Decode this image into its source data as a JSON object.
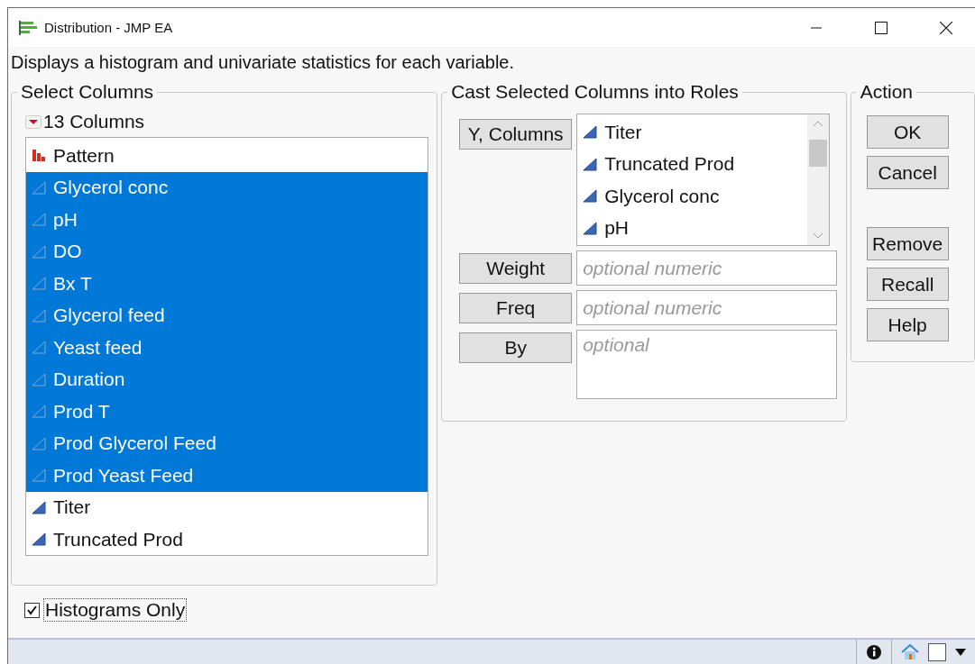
{
  "window": {
    "title": "Distribution - JMP EA"
  },
  "description": "Displays a histogram and univariate statistics for each variable.",
  "select_columns": {
    "title": "Select Columns",
    "count": "13 Columns",
    "columns": [
      {
        "name": "Pattern",
        "kind": "nominal",
        "selected": false
      },
      {
        "name": "Glycerol conc",
        "kind": "continuous",
        "selected": true
      },
      {
        "name": "pH",
        "kind": "continuous",
        "selected": true
      },
      {
        "name": "DO",
        "kind": "continuous",
        "selected": true
      },
      {
        "name": "Bx T",
        "kind": "continuous",
        "selected": true
      },
      {
        "name": "Glycerol feed",
        "kind": "continuous",
        "selected": true
      },
      {
        "name": "Yeast feed",
        "kind": "continuous",
        "selected": true
      },
      {
        "name": "Duration",
        "kind": "continuous",
        "selected": true
      },
      {
        "name": "Prod T",
        "kind": "continuous",
        "selected": true
      },
      {
        "name": "Prod Glycerol Feed",
        "kind": "continuous",
        "selected": true
      },
      {
        "name": "Prod Yeast Feed",
        "kind": "continuous",
        "selected": true
      },
      {
        "name": "Titer",
        "kind": "continuous",
        "selected": false
      },
      {
        "name": "Truncated Prod",
        "kind": "continuous",
        "selected": false
      }
    ]
  },
  "roles": {
    "title": "Cast Selected Columns into Roles",
    "rows": [
      {
        "kind": "list",
        "button": "Y, Columns",
        "items": [
          "Titer",
          "Truncated Prod",
          "Glycerol conc",
          "pH"
        ]
      },
      {
        "kind": "field",
        "button": "Weight",
        "placeholder": "optional numeric"
      },
      {
        "kind": "field",
        "button": "Freq",
        "placeholder": "optional numeric"
      },
      {
        "kind": "area",
        "button": "By",
        "placeholder": "optional"
      }
    ]
  },
  "action": {
    "title": "Action",
    "groups": [
      [
        "OK",
        "Cancel"
      ],
      [
        "Remove",
        "Recall",
        "Help"
      ]
    ]
  },
  "histograms_only": {
    "label": "Histograms Only",
    "checked": true
  }
}
